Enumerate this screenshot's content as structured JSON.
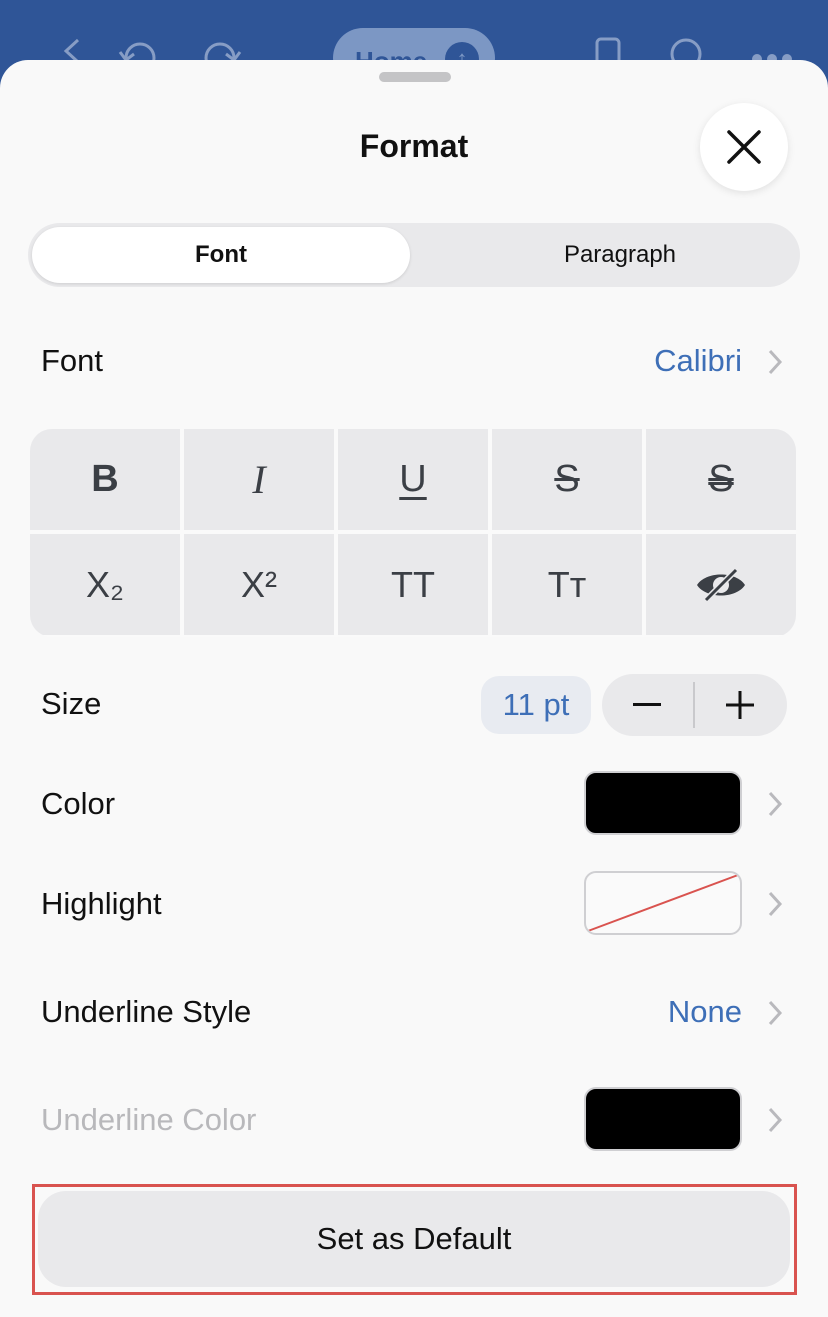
{
  "appbar": {
    "tab_label": "Home"
  },
  "sheet": {
    "title": "Format",
    "close_icon": "close-icon"
  },
  "segment": {
    "tabs": [
      {
        "label": "Font",
        "selected": true
      },
      {
        "label": "Paragraph",
        "selected": false
      }
    ]
  },
  "font_row": {
    "label": "Font",
    "value": "Calibri"
  },
  "style_buttons": [
    {
      "name": "bold",
      "glyph": "B"
    },
    {
      "name": "italic",
      "glyph": "I"
    },
    {
      "name": "underline",
      "glyph": "U"
    },
    {
      "name": "strikethrough",
      "glyph": "S"
    },
    {
      "name": "double-strikethrough",
      "glyph": "S"
    },
    {
      "name": "subscript",
      "glyph": "X₂"
    },
    {
      "name": "superscript",
      "glyph": "X²"
    },
    {
      "name": "all-caps",
      "glyph": "TT"
    },
    {
      "name": "small-caps",
      "glyph": "Tт"
    },
    {
      "name": "hidden",
      "glyph": "eye-slash-icon"
    }
  ],
  "size_row": {
    "label": "Size",
    "value": "11 pt",
    "decrement": "−",
    "increment": "+"
  },
  "color_row": {
    "label": "Color",
    "swatch_color": "#000000"
  },
  "highlight_row": {
    "label": "Highlight",
    "swatch_color": "none"
  },
  "underline_style_row": {
    "label": "Underline Style",
    "value": "None"
  },
  "underline_color_row": {
    "label": "Underline Color",
    "swatch_color": "#000000",
    "disabled": true
  },
  "default_button": {
    "label": "Set as Default"
  },
  "colors": {
    "accent": "#3e6fb7",
    "app_bar": "#2f5597",
    "highlight_outline": "#d9534f"
  }
}
